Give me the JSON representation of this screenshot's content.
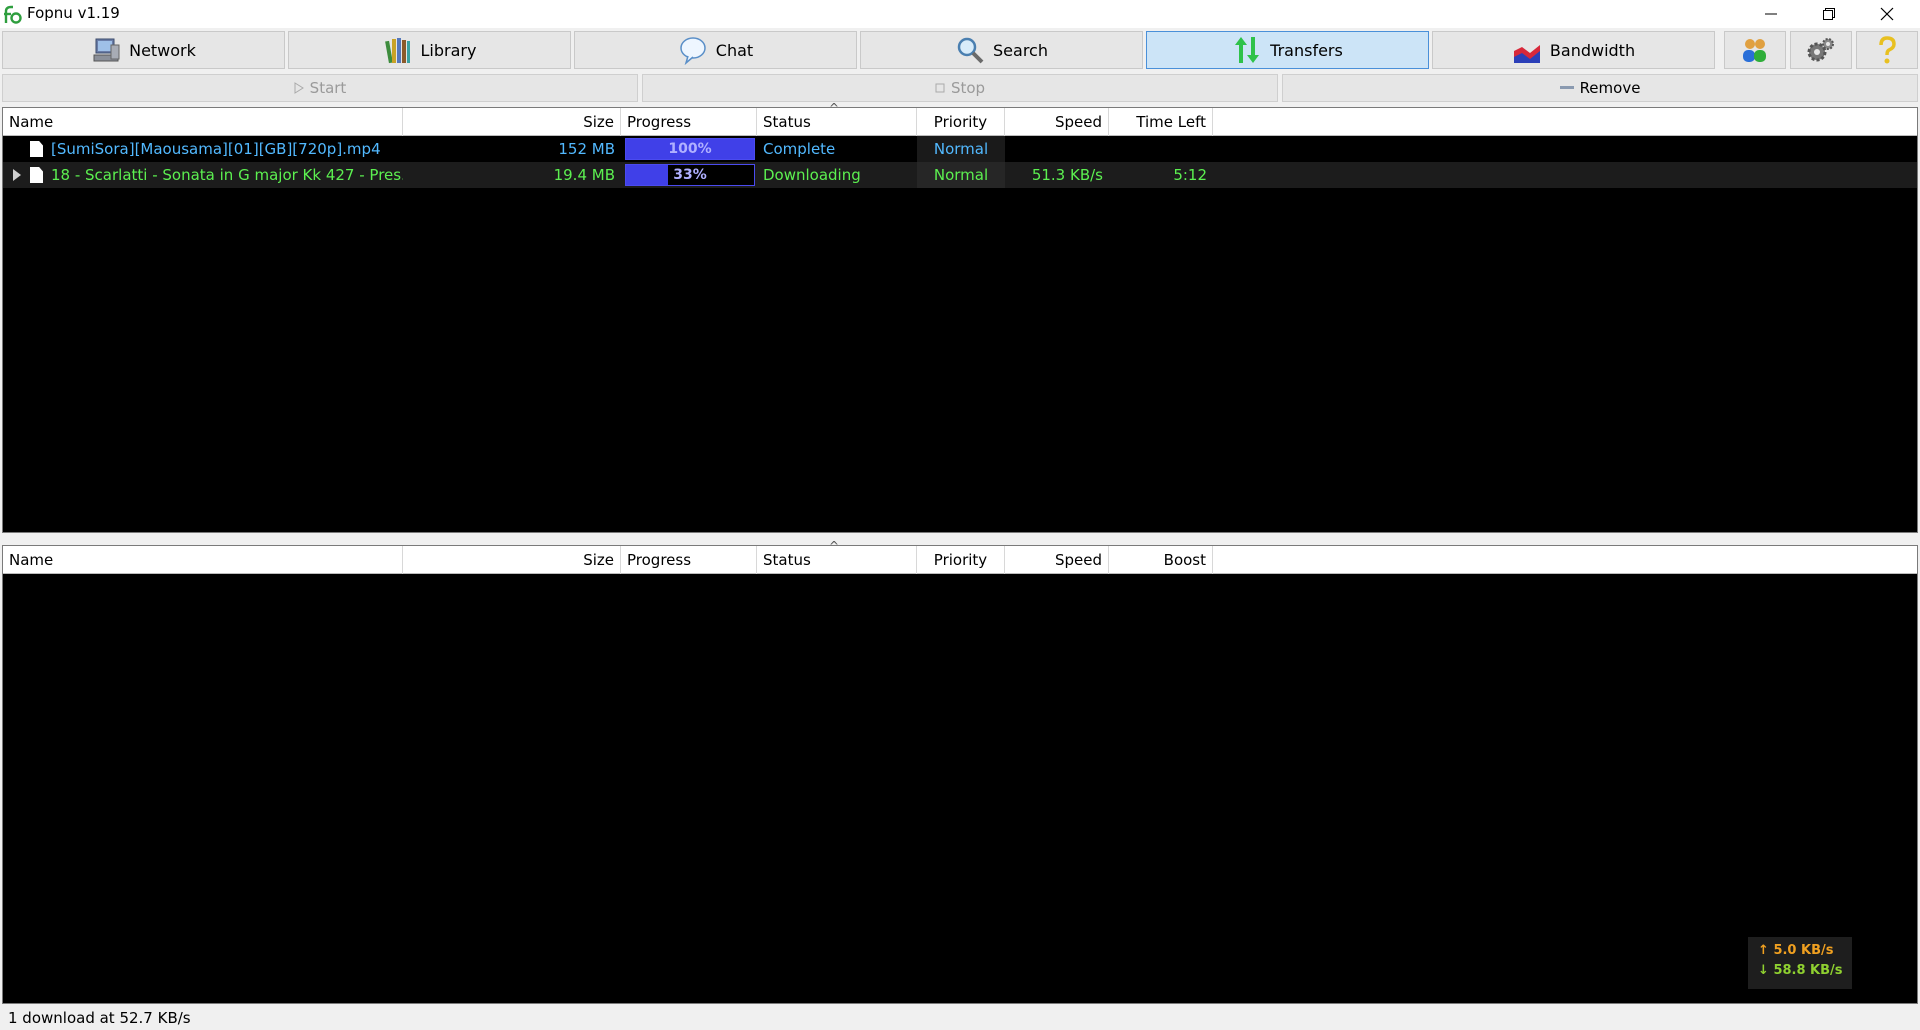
{
  "window": {
    "title": "Fopnu v1.19"
  },
  "toolbar": {
    "network": "Network",
    "library": "Library",
    "chat": "Chat",
    "search": "Search",
    "transfers": "Transfers",
    "bandwidth": "Bandwidth"
  },
  "actions": {
    "start": "Start",
    "stop": "Stop",
    "remove": "Remove"
  },
  "downloads": {
    "columns": {
      "name": "Name",
      "size": "Size",
      "progress": "Progress",
      "status": "Status",
      "priority": "Priority",
      "speed": "Speed",
      "time_left": "Time Left"
    },
    "rows": [
      {
        "name": "[SumiSora][Maousama][01][GB][720p].mp4",
        "size": "152 MB",
        "progress_pct": 100,
        "progress_text": "100%",
        "status": "Complete",
        "priority": "Normal",
        "speed": "",
        "time_left": ""
      },
      {
        "name": "18 - Scarlatti - Sonata in G major Kk 427 - Pres...",
        "size": "19.4 MB",
        "progress_pct": 33,
        "progress_text": "33%",
        "status": "Downloading",
        "priority": "Normal",
        "speed": "51.3 KB/s",
        "time_left": "5:12"
      }
    ]
  },
  "uploads": {
    "columns": {
      "name": "Name",
      "size": "Size",
      "progress": "Progress",
      "status": "Status",
      "priority": "Priority",
      "speed": "Speed",
      "boost": "Boost"
    }
  },
  "speed_overlay": {
    "up": "5.0 KB/s",
    "down": "58.8 KB/s"
  },
  "statusbar": {
    "text": "1 download at 52.7 KB/s"
  }
}
